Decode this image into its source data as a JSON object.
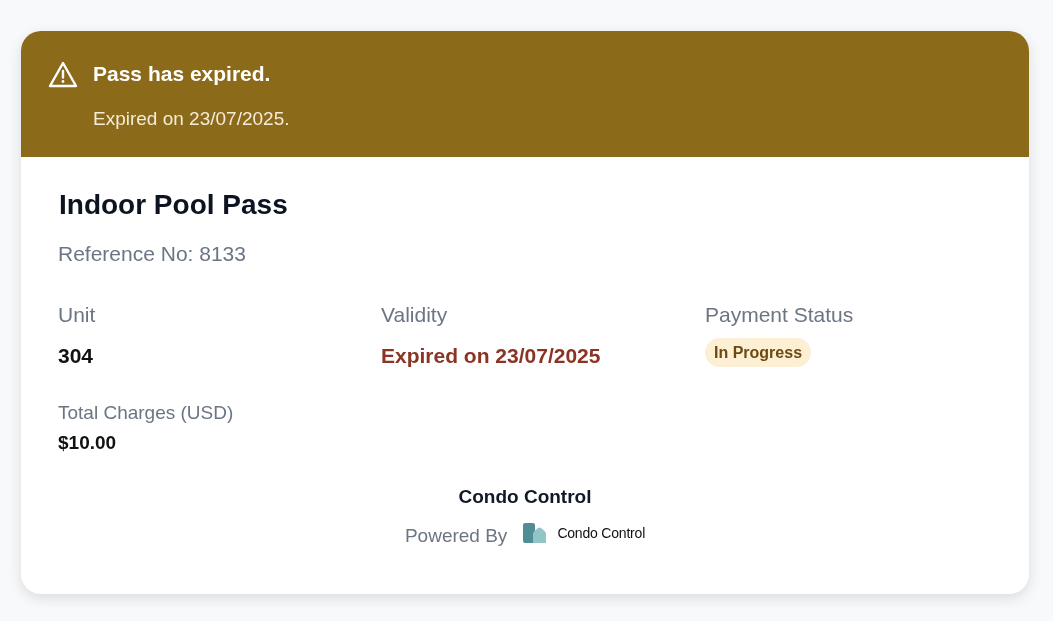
{
  "alert": {
    "kind": "warning",
    "title": "Pass has expired.",
    "message": "Expired on 23/07/2025."
  },
  "pass": {
    "title": "Indoor Pool Pass",
    "reference": "Reference No: 8133"
  },
  "details": [
    {
      "kind": "plain",
      "label": "Unit",
      "value": "304"
    },
    {
      "kind": "danger",
      "label": "Validity",
      "value": "Expired on 23/07/2025"
    },
    {
      "kind": "badge",
      "label": "Payment Status",
      "value": "In Progress"
    }
  ],
  "total": {
    "label": "Total Charges (USD)",
    "value": "$10.00"
  },
  "footer": {
    "company": "Condo Control",
    "powered_by": "Powered By",
    "logo_text": "Condo Control"
  }
}
